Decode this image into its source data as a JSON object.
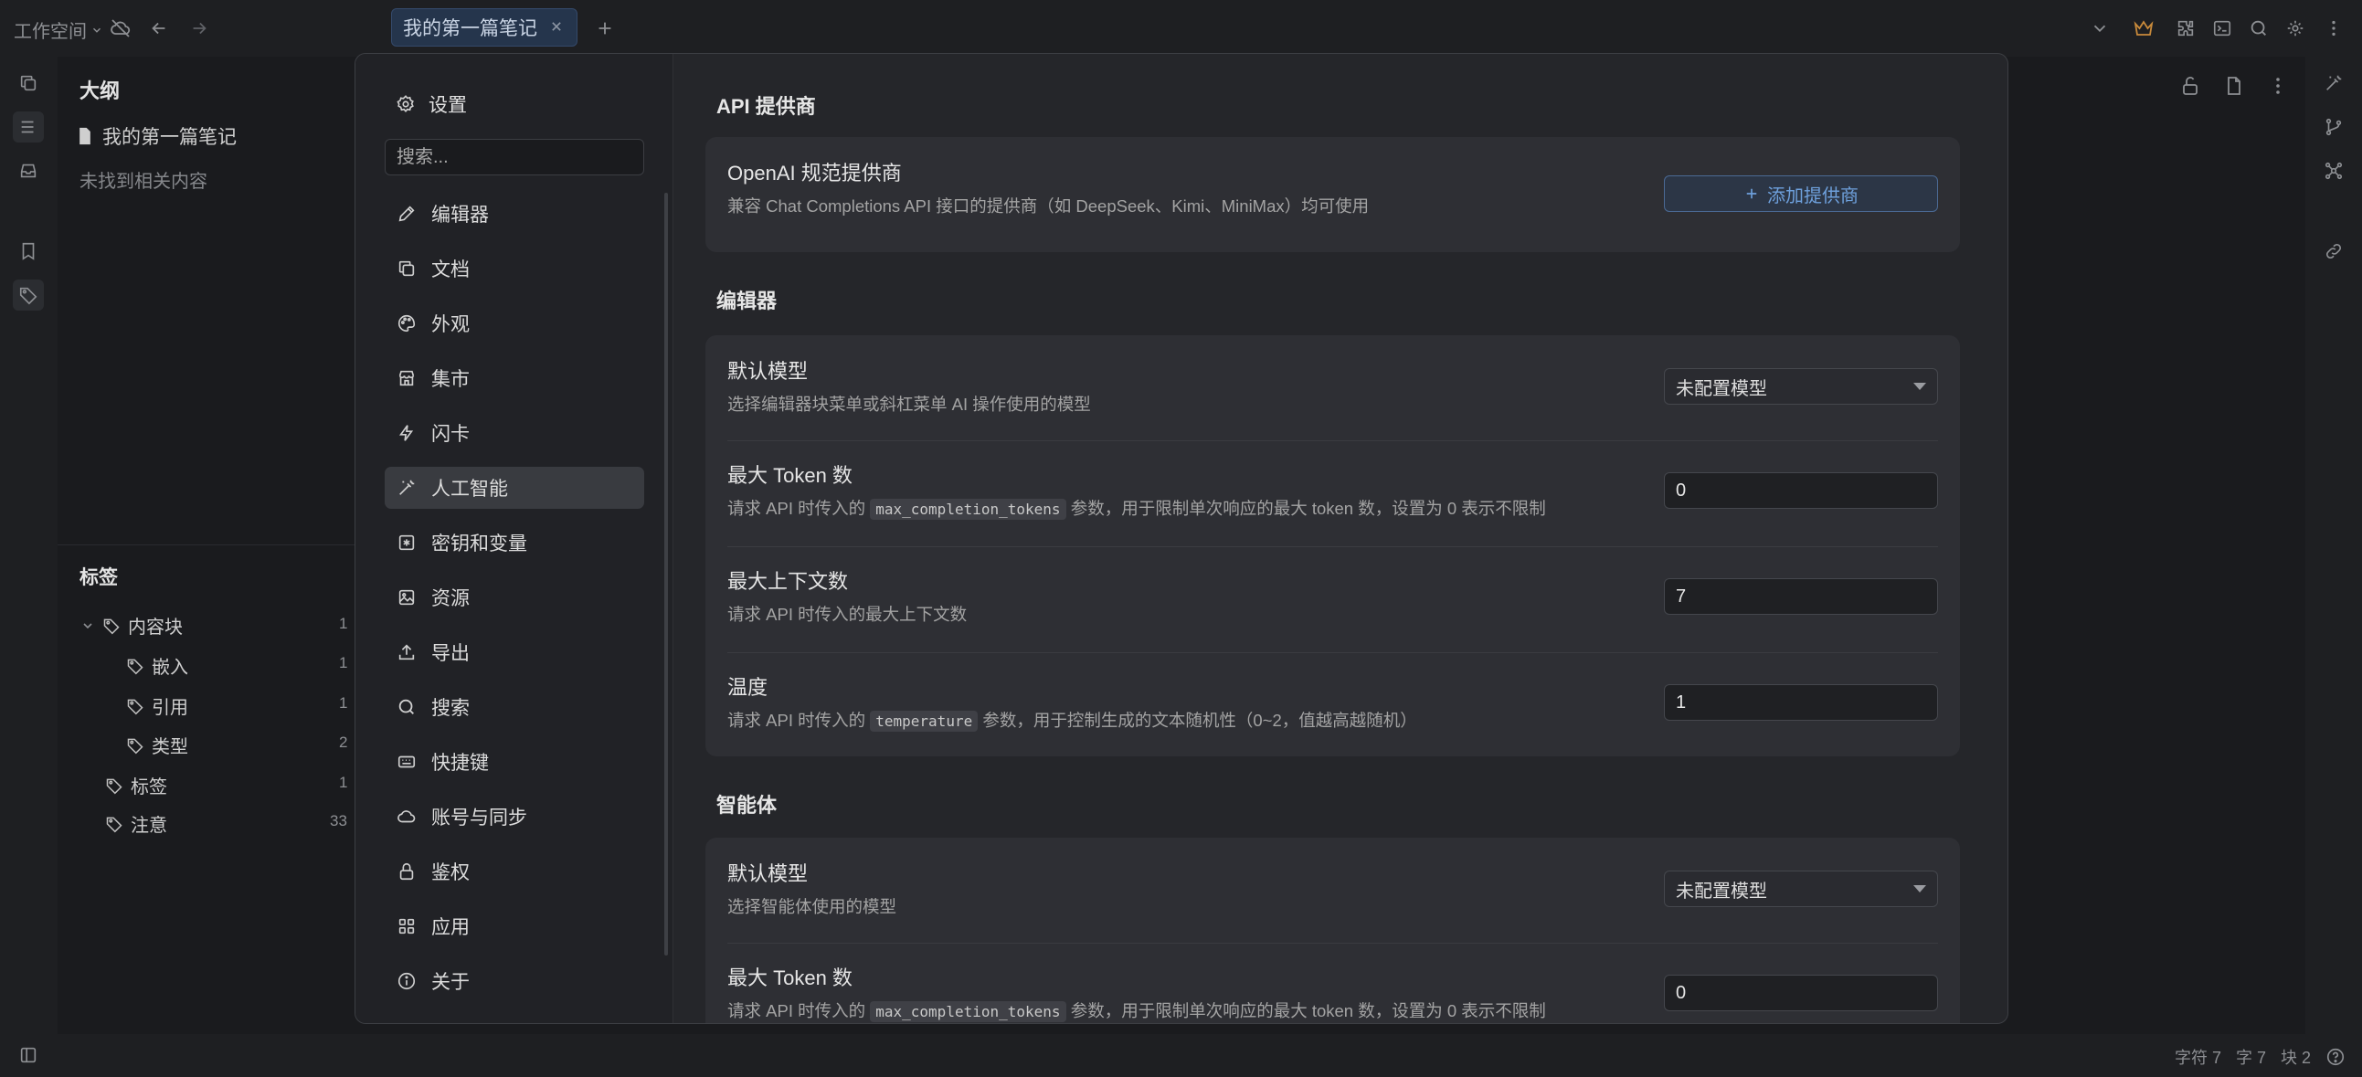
{
  "topbar": {
    "workspace_label": "工作空间",
    "tab_title": "我的第一篇笔记"
  },
  "sidebar": {
    "outline_title": "大纲",
    "outline_doc": "我的第一篇笔记",
    "outline_empty": "未找到相关内容",
    "tags_title": "标签",
    "tags": [
      {
        "label": "内容块",
        "count": "1"
      },
      {
        "label": "嵌入",
        "count": "1"
      },
      {
        "label": "引用",
        "count": "1"
      },
      {
        "label": "类型",
        "count": "2"
      },
      {
        "label": "标签",
        "count": "1"
      },
      {
        "label": "注意",
        "count": "33"
      }
    ]
  },
  "settings": {
    "title": "设置",
    "search_placeholder": "搜索...",
    "nav": [
      {
        "label": "编辑器",
        "icon": "pencil-icon"
      },
      {
        "label": "文档",
        "icon": "copy-icon"
      },
      {
        "label": "外观",
        "icon": "palette-icon"
      },
      {
        "label": "集市",
        "icon": "store-icon"
      },
      {
        "label": "闪卡",
        "icon": "bolt-icon"
      },
      {
        "label": "人工智能",
        "icon": "wand-icon",
        "active": true
      },
      {
        "label": "密钥和变量",
        "icon": "asterisk-icon"
      },
      {
        "label": "资源",
        "icon": "image-icon"
      },
      {
        "label": "导出",
        "icon": "upload-icon"
      },
      {
        "label": "搜索",
        "icon": "search-icon"
      },
      {
        "label": "快捷键",
        "icon": "keyboard-icon"
      },
      {
        "label": "账号与同步",
        "icon": "cloud-icon"
      },
      {
        "label": "鉴权",
        "icon": "lock-icon"
      },
      {
        "label": "应用",
        "icon": "grid-icon"
      },
      {
        "label": "关于",
        "icon": "info-icon"
      }
    ],
    "sections": {
      "provider": {
        "title": "API 提供商",
        "label": "OpenAI 规范提供商",
        "desc": "兼容 Chat Completions API 接口的提供商（如 DeepSeek、Kimi、MiniMax）均可使用",
        "button": "添加提供商"
      },
      "editor": {
        "title": "编辑器",
        "default_model": {
          "label": "默认模型",
          "desc": "选择编辑器块菜单或斜杠菜单 AI 操作使用的模型",
          "value": "未配置模型"
        },
        "max_tokens": {
          "label": "最大 Token 数",
          "desc_pre": "请求 API 时传入的",
          "code": "max_completion_tokens",
          "desc_post": "参数，用于限制单次响应的最大 token 数，设置为 0 表示不限制",
          "value": "0"
        },
        "max_context": {
          "label": "最大上下文数",
          "desc": "请求 API 时传入的最大上下文数",
          "value": "7"
        },
        "temperature": {
          "label": "温度",
          "desc_pre": "请求 API 时传入的",
          "code": "temperature",
          "desc_post": "参数，用于控制生成的文本随机性（0~2，值越高越随机）",
          "value": "1"
        }
      },
      "agent": {
        "title": "智能体",
        "default_model": {
          "label": "默认模型",
          "desc": "选择智能体使用的模型",
          "value": "未配置模型"
        },
        "max_tokens": {
          "label": "最大 Token 数",
          "desc_pre": "请求 API 时传入的",
          "code": "max_completion_tokens",
          "desc_post": "参数，用于限制单次响应的最大 token 数，设置为 0 表示不限制",
          "value": "0"
        }
      }
    }
  },
  "status": {
    "chars": "字符 7",
    "words": "字 7",
    "blocks": "块 2"
  },
  "colors": {
    "accent": "#6ea0dc",
    "crown": "#c98a3b"
  }
}
